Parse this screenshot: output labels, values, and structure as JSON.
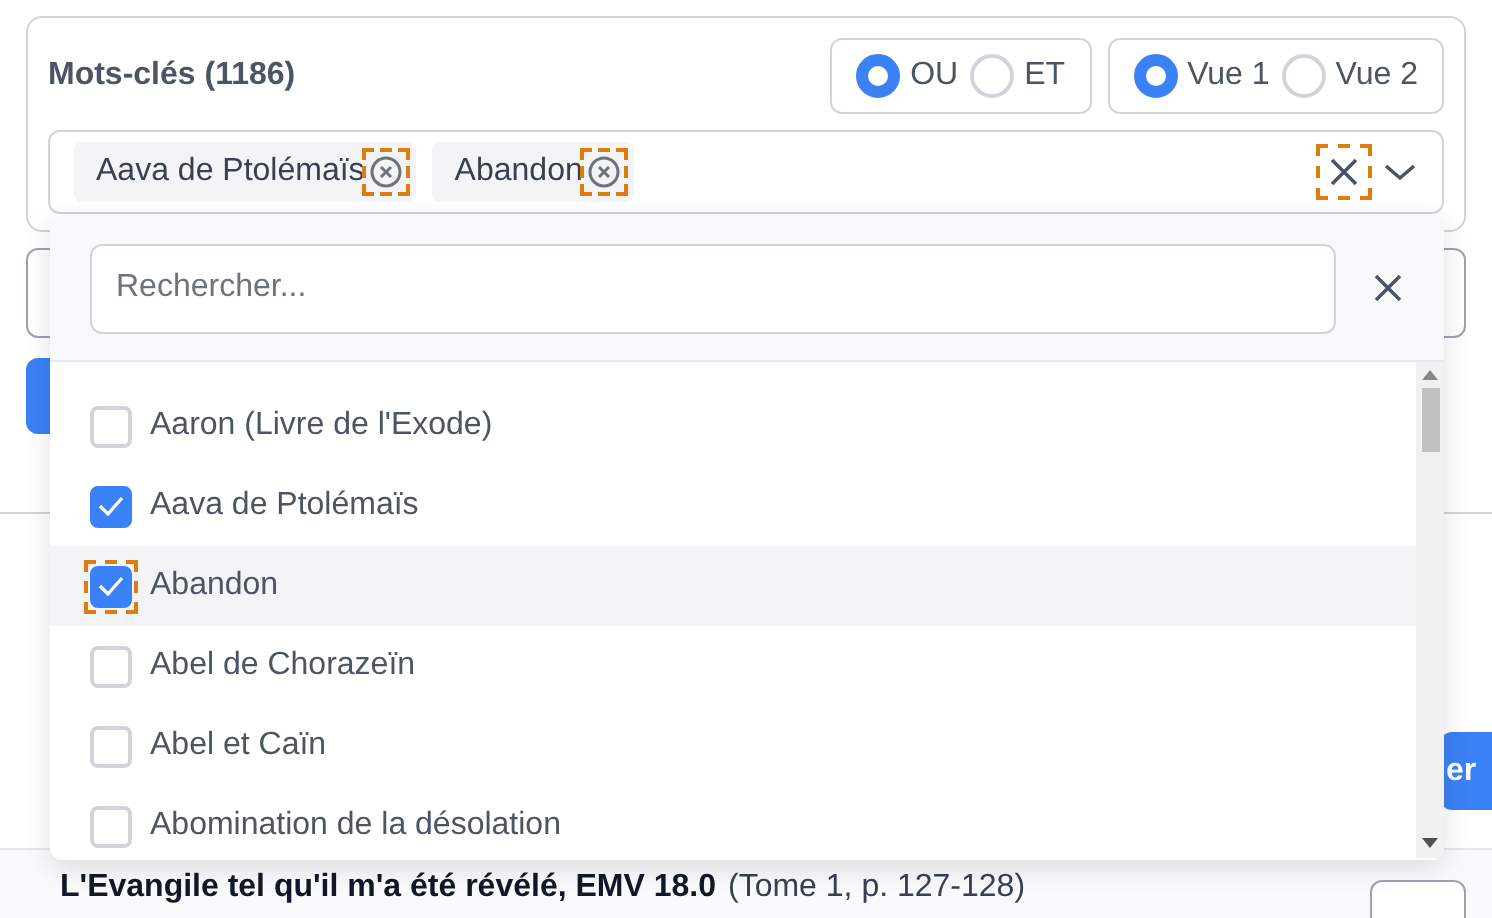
{
  "keywords": {
    "label": "Mots-clés (1186)",
    "operator": [
      {
        "label": "OU",
        "selected": true
      },
      {
        "label": "ET",
        "selected": false
      }
    ],
    "view": [
      {
        "label": "Vue 1",
        "selected": true
      },
      {
        "label": "Vue 2",
        "selected": false
      }
    ],
    "tags": [
      {
        "label": "Aava de Ptolémaïs",
        "marked": true
      },
      {
        "label": "Abandon",
        "marked": true
      }
    ],
    "clear_marked": true
  },
  "dropdown": {
    "search": {
      "placeholder": "Rechercher..."
    },
    "options": [
      {
        "label": "Aaron (Livre de l'Exode)",
        "checked": false,
        "hovered": false,
        "marked": false
      },
      {
        "label": "Aava de Ptolémaïs",
        "checked": true,
        "hovered": false,
        "marked": false
      },
      {
        "label": "Abandon",
        "checked": true,
        "hovered": true,
        "marked": true
      },
      {
        "label": "Abel de Chorazeïn",
        "checked": false,
        "hovered": false,
        "marked": false
      },
      {
        "label": "Abel et Caïn",
        "checked": false,
        "hovered": false,
        "marked": false
      },
      {
        "label": "Abomination de la désolation",
        "checked": false,
        "hovered": false,
        "marked": false
      }
    ]
  },
  "side_button": {
    "label": "er"
  },
  "footer": {
    "title": "L'Evangile tel qu'il m'a été révélé, EMV 18.0",
    "reference": "(Tome 1, p. 127-128)"
  }
}
